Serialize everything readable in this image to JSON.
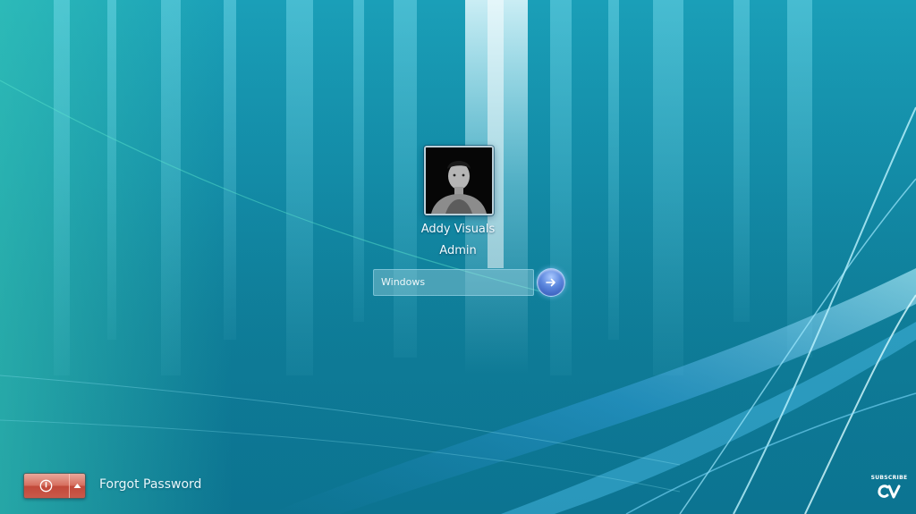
{
  "user": {
    "name": "Addy Visuals",
    "role": "Admin"
  },
  "password": {
    "value": "",
    "placeholder": "Windows"
  },
  "actions": {
    "submit_icon": "arrow-right-icon",
    "power_icon": "power-icon",
    "power_options_icon": "caret-up-icon"
  },
  "footer": {
    "forgot_password": "Forgot Password",
    "subscribe": "SUBSCRIBE",
    "logo_text": "CV"
  },
  "colors": {
    "background": "#1592ad",
    "power_button": "#d2604f",
    "submit_button": "#4a74d0",
    "text": "#f2fbff"
  }
}
